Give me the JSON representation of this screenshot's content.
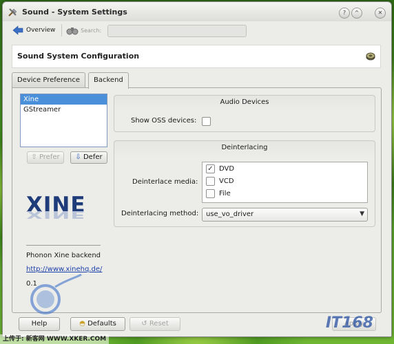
{
  "window": {
    "title": "Sound - System Settings",
    "controls": [
      "help-icon",
      "minimize-icon",
      "close-icon"
    ]
  },
  "toolbar": {
    "overview_label": "Overview",
    "search_label": "Search:",
    "search_value": ""
  },
  "header": {
    "title": "Sound System Configuration",
    "icon": "speaker-icon"
  },
  "tabs": [
    {
      "label": "Device Preference",
      "active": false
    },
    {
      "label": "Backend",
      "active": true
    }
  ],
  "backend": {
    "items": [
      {
        "label": "Xine",
        "selected": true
      },
      {
        "label": "GStreamer",
        "selected": false
      }
    ],
    "prefer_label": "Prefer",
    "defer_label": "Defer",
    "logo_text": "XINE",
    "name": "Phonon Xine backend",
    "url": "http://www.xinehq.de/",
    "version": "0.1"
  },
  "audio_devices": {
    "title": "Audio Devices",
    "show_oss_label": "Show OSS devices:",
    "show_oss_checked": false
  },
  "deinterlacing": {
    "title": "Deinterlacing",
    "media_label": "Deinterlace media:",
    "media": [
      {
        "label": "DVD",
        "checked": true
      },
      {
        "label": "VCD",
        "checked": false
      },
      {
        "label": "File",
        "checked": false
      }
    ],
    "method_label": "Deinterlacing method:",
    "method_value": "use_vo_driver"
  },
  "buttons": {
    "help_label": "Help",
    "defaults_label": "Defaults",
    "reset_label": "Reset",
    "apply_label": "Apply"
  },
  "watermark": {
    "left_text": "上传于: 新客网 WWW.XKER.COM",
    "right_text": "IT168"
  }
}
